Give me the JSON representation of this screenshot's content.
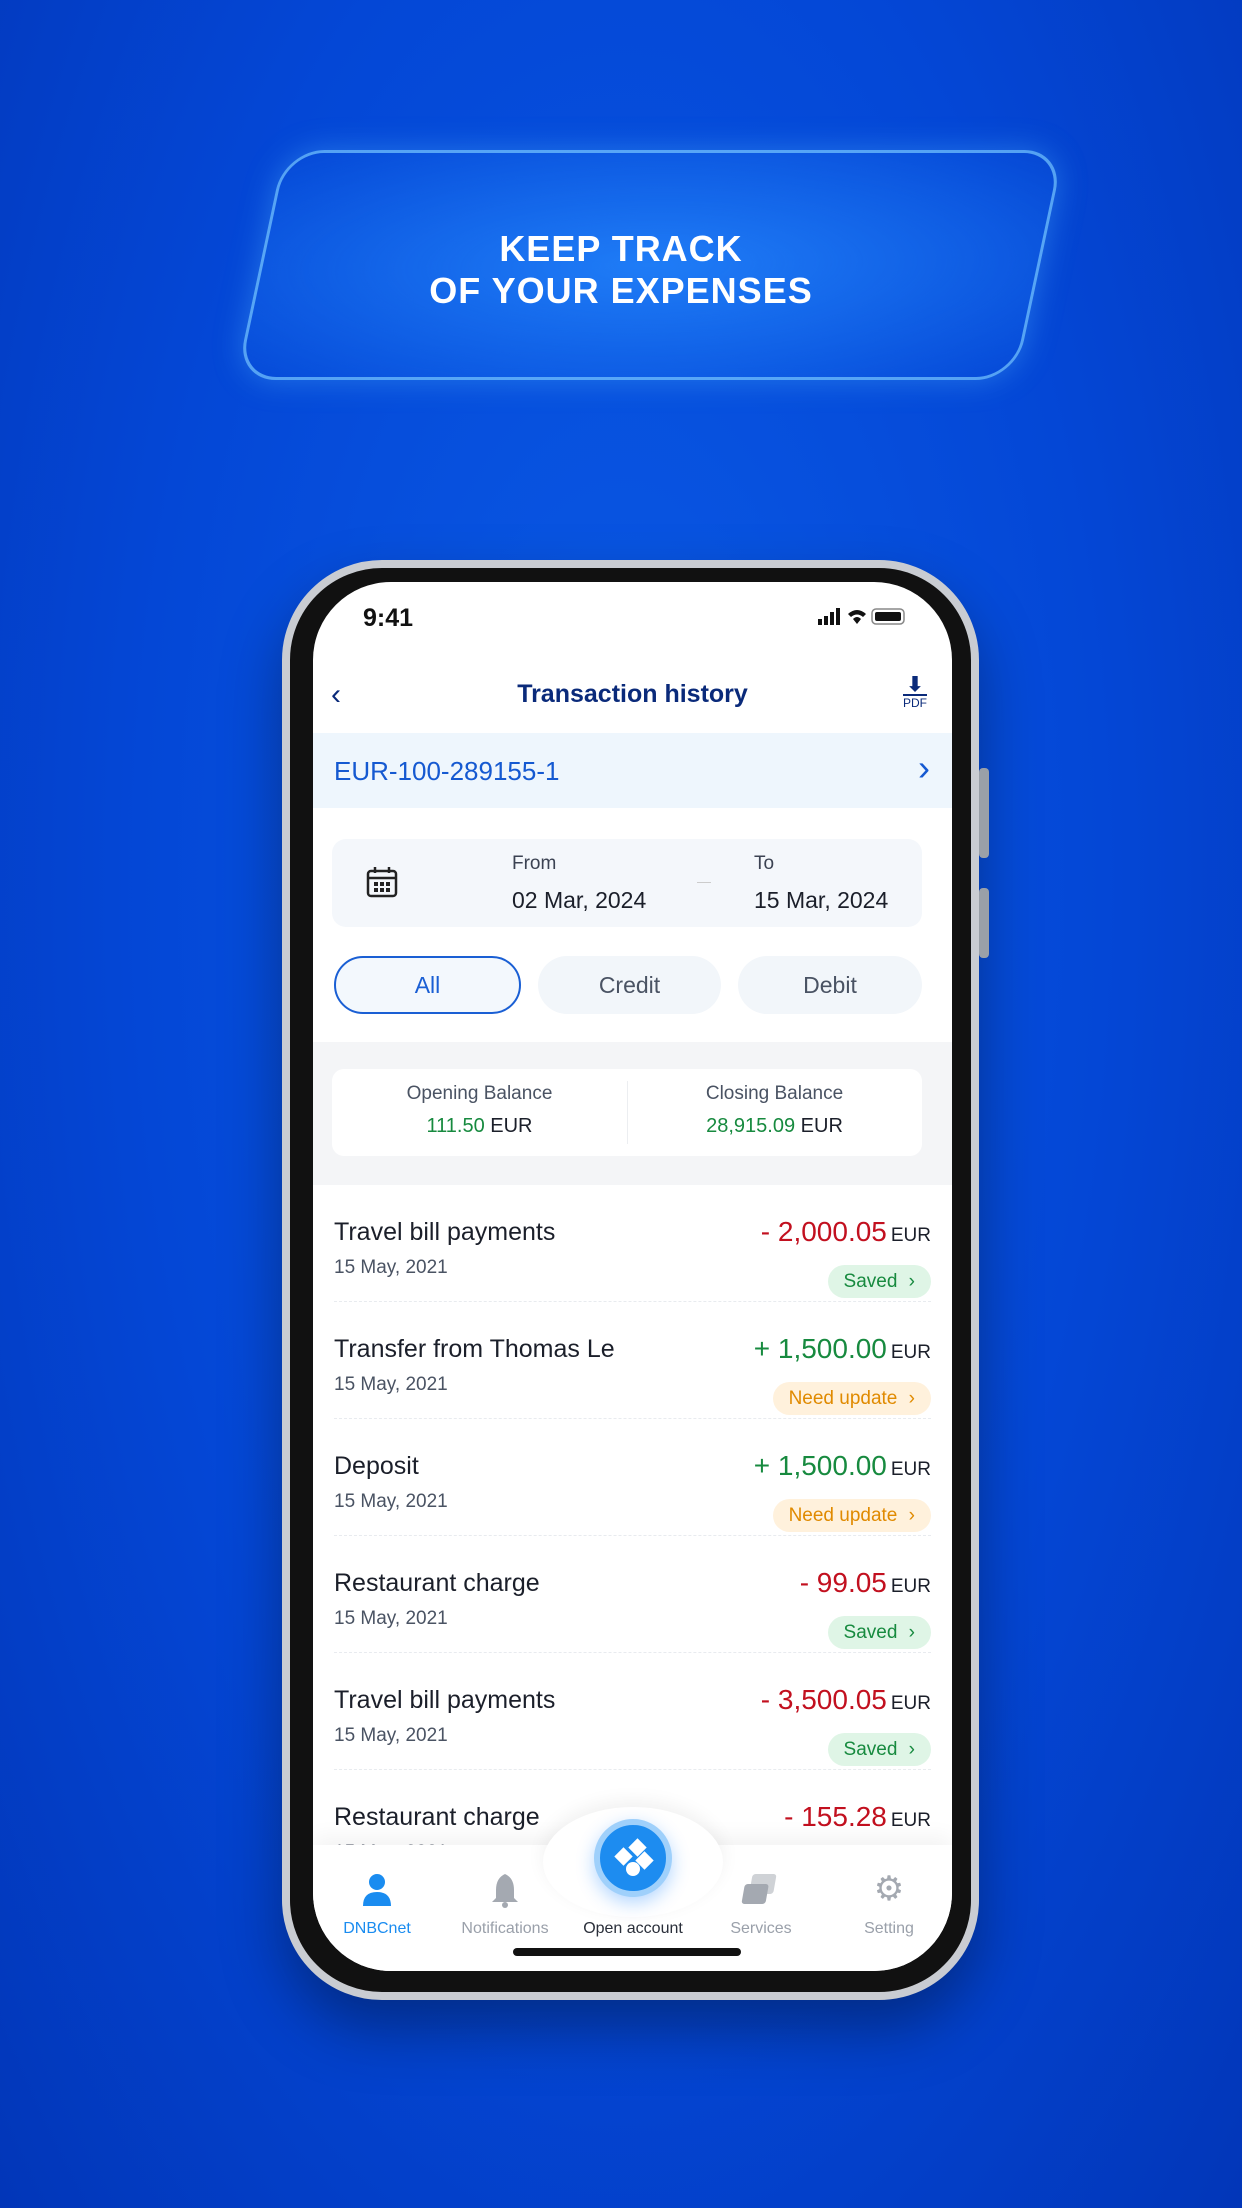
{
  "banner": {
    "line1": "KEEP TRACK",
    "line2": "OF YOUR EXPENSES"
  },
  "status": {
    "time": "9:41"
  },
  "header": {
    "title": "Transaction history",
    "pdf_label": "PDF"
  },
  "account": {
    "number": "EUR-100-289155-1"
  },
  "date_range": {
    "from_label": "From",
    "from_value": "02 Mar, 2024",
    "to_label": "To",
    "to_value": "15 Mar, 2024"
  },
  "filters": [
    {
      "label": "All",
      "active": true
    },
    {
      "label": "Credit",
      "active": false
    },
    {
      "label": "Debit",
      "active": false
    }
  ],
  "balances": {
    "opening_label": "Opening Balance",
    "opening_value": "111.50",
    "closing_label": "Closing Balance",
    "closing_value": "28,915.09",
    "currency": "EUR"
  },
  "transactions": [
    {
      "title": "Travel bill payments",
      "date": "15 May, 2021",
      "amount": "- 2,000.05",
      "currency": "EUR",
      "type": "debit",
      "status": "Saved"
    },
    {
      "title": "Transfer from Thomas Le",
      "date": "15 May, 2021",
      "amount": "+ 1,500.00",
      "currency": "EUR",
      "type": "credit",
      "status": "Need update"
    },
    {
      "title": "Deposit",
      "date": "15 May, 2021",
      "amount": "+ 1,500.00",
      "currency": "EUR",
      "type": "credit",
      "status": "Need update"
    },
    {
      "title": "Restaurant charge",
      "date": "15 May, 2021",
      "amount": "- 99.05",
      "currency": "EUR",
      "type": "debit",
      "status": "Saved"
    },
    {
      "title": "Travel bill payments",
      "date": "15 May, 2021",
      "amount": "- 3,500.05",
      "currency": "EUR",
      "type": "debit",
      "status": "Saved"
    },
    {
      "title": "Restaurant charge",
      "date": "15 May, 2021",
      "amount": "- 155.28",
      "currency": "EUR",
      "type": "debit",
      "status": ""
    }
  ],
  "nav": [
    {
      "label": "DNBCnet",
      "icon": "user-icon",
      "active": true
    },
    {
      "label": "Notifications",
      "icon": "bell-icon",
      "active": false
    },
    {
      "label": "Open account",
      "icon": "open-account-icon",
      "active": false
    },
    {
      "label": "Services",
      "icon": "services-icon",
      "active": false
    },
    {
      "label": "Setting",
      "icon": "gear-icon",
      "active": false
    }
  ],
  "colors": {
    "background": "#0447d6",
    "accent": "#1a5fd4",
    "debit": "#c2101f",
    "credit": "#178a3f",
    "warning": "#e08a00"
  }
}
